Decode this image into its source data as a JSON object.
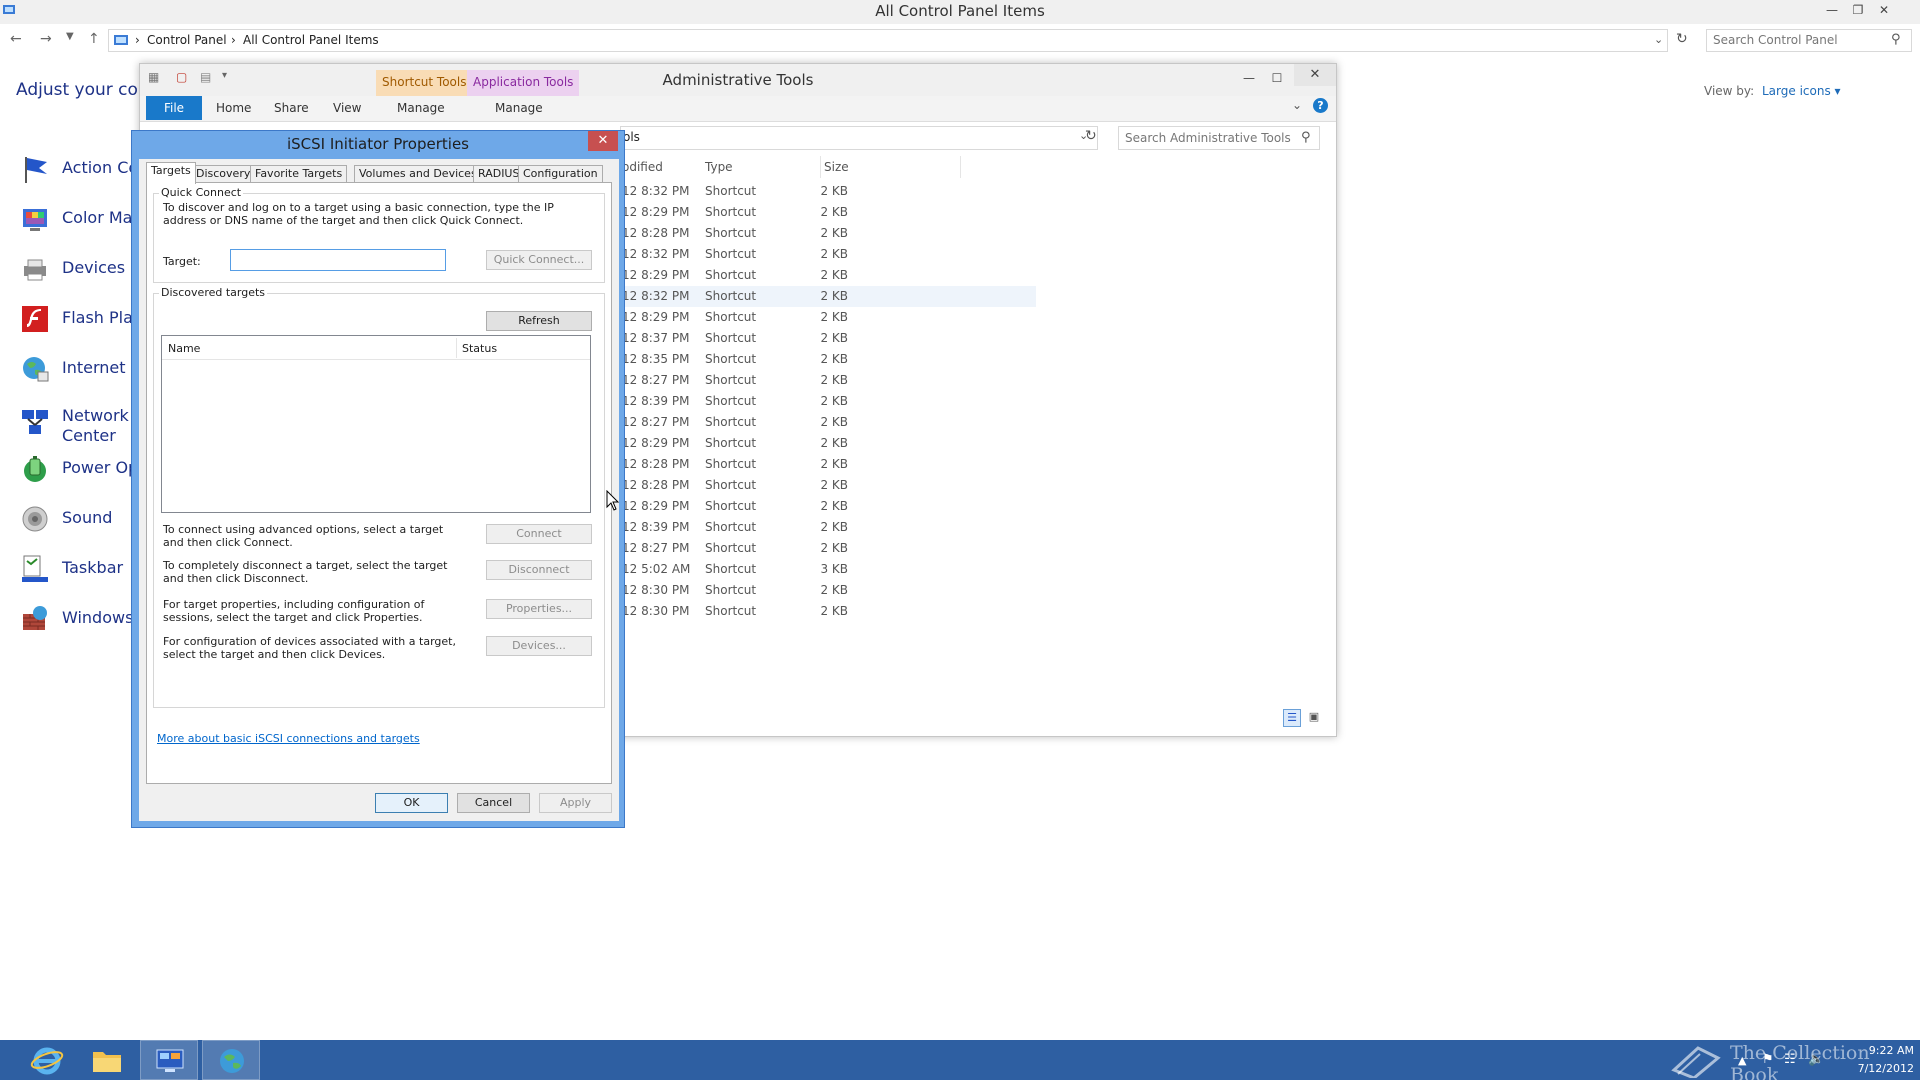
{
  "control_panel": {
    "title": "All Control Panel Items",
    "breadcrumb": [
      "Control Panel",
      "All Control Panel Items"
    ],
    "search_placeholder": "Search Control Panel",
    "heading": "Adjust your comp",
    "view_by_label": "View by:",
    "view_by_value": "Large icons",
    "items": [
      {
        "label": "Action Ce",
        "icon": "flag-icon"
      },
      {
        "label": "Color Mar",
        "icon": "color-management-icon"
      },
      {
        "label": "Devices ar",
        "icon": "printer-icon"
      },
      {
        "label": "Flash Play",
        "icon": "flash-icon"
      },
      {
        "label": "Internet O",
        "icon": "globe-icon"
      },
      {
        "label": "Network a",
        "label2": "Center",
        "icon": "network-icon"
      },
      {
        "label": "Power Op",
        "icon": "battery-icon"
      },
      {
        "label": "Sound",
        "icon": "speaker-icon"
      },
      {
        "label": "Taskbar",
        "icon": "taskbar-icon"
      },
      {
        "label": "Windows",
        "icon": "firewall-icon"
      }
    ]
  },
  "admin_tools": {
    "title": "Administrative Tools",
    "context_tabs": [
      "Shortcut Tools",
      "Application Tools"
    ],
    "ribbon_tabs": [
      "File",
      "Home",
      "Share",
      "View",
      "Manage",
      "Manage"
    ],
    "path_fragment": "ols",
    "search_placeholder": "Search Administrative Tools",
    "columns": [
      "odified",
      "Type",
      "Size"
    ],
    "files": [
      {
        "modified": "12 8:32 PM",
        "type": "Shortcut",
        "size": "2 KB"
      },
      {
        "modified": "12 8:29 PM",
        "type": "Shortcut",
        "size": "2 KB"
      },
      {
        "modified": "12 8:28 PM",
        "type": "Shortcut",
        "size": "2 KB"
      },
      {
        "modified": "12 8:32 PM",
        "type": "Shortcut",
        "size": "2 KB"
      },
      {
        "modified": "12 8:29 PM",
        "type": "Shortcut",
        "size": "2 KB"
      },
      {
        "modified": "12 8:32 PM",
        "type": "Shortcut",
        "size": "2 KB"
      },
      {
        "modified": "12 8:29 PM",
        "type": "Shortcut",
        "size": "2 KB"
      },
      {
        "modified": "12 8:37 PM",
        "type": "Shortcut",
        "size": "2 KB"
      },
      {
        "modified": "12 8:35 PM",
        "type": "Shortcut",
        "size": "2 KB"
      },
      {
        "modified": "12 8:27 PM",
        "type": "Shortcut",
        "size": "2 KB"
      },
      {
        "modified": "12 8:39 PM",
        "type": "Shortcut",
        "size": "2 KB"
      },
      {
        "modified": "12 8:27 PM",
        "type": "Shortcut",
        "size": "2 KB"
      },
      {
        "modified": "12 8:29 PM",
        "type": "Shortcut",
        "size": "2 KB"
      },
      {
        "modified": "12 8:28 PM",
        "type": "Shortcut",
        "size": "2 KB"
      },
      {
        "modified": "12 8:28 PM",
        "type": "Shortcut",
        "size": "2 KB"
      },
      {
        "modified": "12 8:29 PM",
        "type": "Shortcut",
        "size": "2 KB"
      },
      {
        "modified": "12 8:39 PM",
        "type": "Shortcut",
        "size": "2 KB"
      },
      {
        "modified": "12 8:27 PM",
        "type": "Shortcut",
        "size": "2 KB"
      },
      {
        "modified": "12 5:02 AM",
        "type": "Shortcut",
        "size": "3 KB"
      },
      {
        "modified": "12 8:30 PM",
        "type": "Shortcut",
        "size": "2 KB"
      },
      {
        "modified": "12 8:30 PM",
        "type": "Shortcut",
        "size": "2 KB"
      }
    ]
  },
  "dialog": {
    "title": "iSCSI Initiator Properties",
    "tabs": [
      "Targets",
      "Discovery",
      "Favorite Targets",
      "Volumes and Devices",
      "RADIUS",
      "Configuration"
    ],
    "active_tab": "Targets",
    "quick_connect": {
      "group_label": "Quick Connect",
      "description": "To discover and log on to a target using a basic connection, type the IP address or DNS name of the target and then click Quick Connect.",
      "target_label": "Target:",
      "target_value": "",
      "button": "Quick Connect..."
    },
    "discovered": {
      "group_label": "Discovered targets",
      "refresh_button": "Refresh",
      "columns": [
        "Name",
        "Status"
      ],
      "actions": [
        {
          "text": "To connect using advanced options, select a target and then click Connect.",
          "button": "Connect"
        },
        {
          "text": "To completely disconnect a target, select the target and then click Disconnect.",
          "button": "Disconnect"
        },
        {
          "text": "For target properties, including configuration of sessions, select the target and click Properties.",
          "button": "Properties..."
        },
        {
          "text": "For configuration of devices associated with a target, select the target and then click Devices.",
          "button": "Devices..."
        }
      ]
    },
    "help_link": "More about basic iSCSI connections and targets",
    "buttons": {
      "ok": "OK",
      "cancel": "Cancel",
      "apply": "Apply"
    }
  },
  "taskbar": {
    "time": "9:22 AM",
    "date": "7/12/2012",
    "watermark": "The Collection Book"
  }
}
